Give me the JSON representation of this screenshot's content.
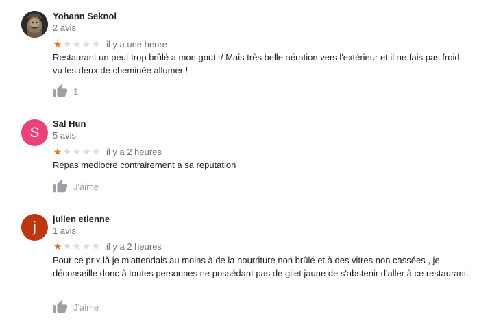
{
  "reviews": [
    {
      "author": "Yohann Seknol",
      "review_count": "2 avis",
      "avatar": {
        "type": "photo",
        "letter": ""
      },
      "rating": 1,
      "date": "il y a une heure",
      "text": "Restaurant un peut trop brûlé a mon gout :/ Mais très belle aération vers l'extérieur et il ne fais pas froid vu les deux de cheminée allumer !",
      "like_label": "1"
    },
    {
      "author": "Sal Hun",
      "review_count": "5 avis",
      "avatar": {
        "type": "letter",
        "letter": "S",
        "color": "#ec407a"
      },
      "rating": 1,
      "date": "il y a 2 heures",
      "text": "Repas mediocre contrairement a sa reputation",
      "like_label": "J'aime"
    },
    {
      "author": "julien etienne",
      "review_count": "1 avis",
      "avatar": {
        "type": "letter",
        "letter": "j",
        "color": "#bf360c"
      },
      "rating": 1,
      "date": "il y a 2 heures",
      "text": "Pour ce prix là je m'attendais au moins à de la nourriture non brûlé et à des vitres non cassées , je déconseille donc à toutes personnes ne possédant pas de gilet jaune de s'abstenir d'aller à ce restaurant.",
      "like_label": "J'aime"
    }
  ],
  "colors": {
    "star_on": "#e7711b",
    "star_off": "#dadce0",
    "secondary_text": "#70757a",
    "primary_text": "#222222",
    "like_icon": "#9aa0a6"
  },
  "icons": {
    "star": "star-icon",
    "like": "thumb-up-icon"
  }
}
